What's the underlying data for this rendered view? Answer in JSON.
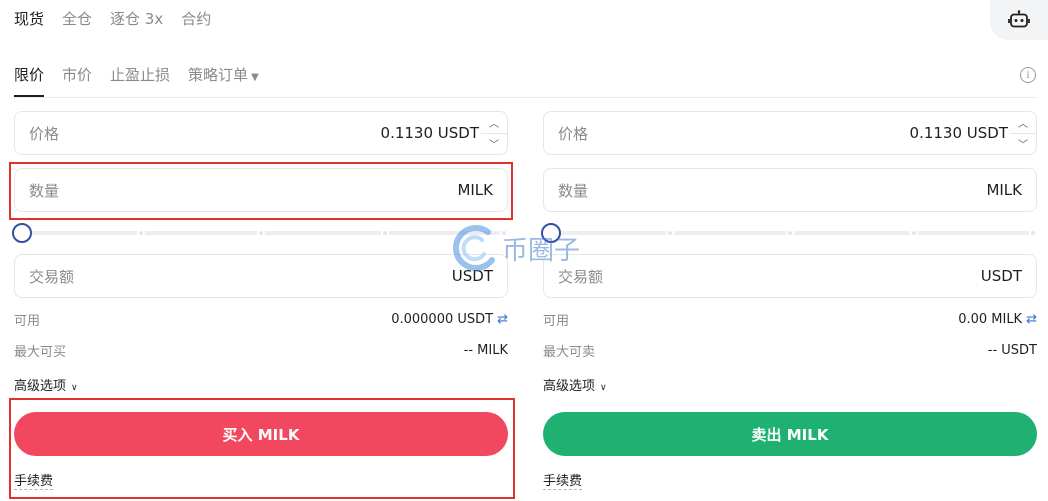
{
  "top_tabs": [
    "现货",
    "全仓",
    "逐仓 3x",
    "合约"
  ],
  "order_tabs": [
    "限价",
    "市价",
    "止盈止损",
    "策略订单"
  ],
  "info_icon": "info-icon",
  "buy": {
    "price_label": "价格",
    "price_value": "0.1130 USDT",
    "qty_label": "数量",
    "qty_unit": "MILK",
    "amount_label": "交易额",
    "amount_unit": "USDT",
    "available_label": "可用",
    "available_value": "0.000000 USDT",
    "max_label": "最大可买",
    "max_value": "-- MILK",
    "advanced_label": "高级选项",
    "button_label": "买入 MILK",
    "fee_label": "手续费"
  },
  "sell": {
    "price_label": "价格",
    "price_value": "0.1130 USDT",
    "qty_label": "数量",
    "qty_unit": "MILK",
    "amount_label": "交易额",
    "amount_unit": "USDT",
    "available_label": "可用",
    "available_value": "0.00 MILK",
    "max_label": "最大可卖",
    "max_value": "-- USDT",
    "advanced_label": "高级选项",
    "button_label": "卖出 MILK",
    "fee_label": "手续费"
  },
  "watermark": "币圈子",
  "colors": {
    "buy": "#f1485f",
    "sell": "#1fb172",
    "highlight": "#e0312b",
    "slider_knob": "#3351a3"
  }
}
